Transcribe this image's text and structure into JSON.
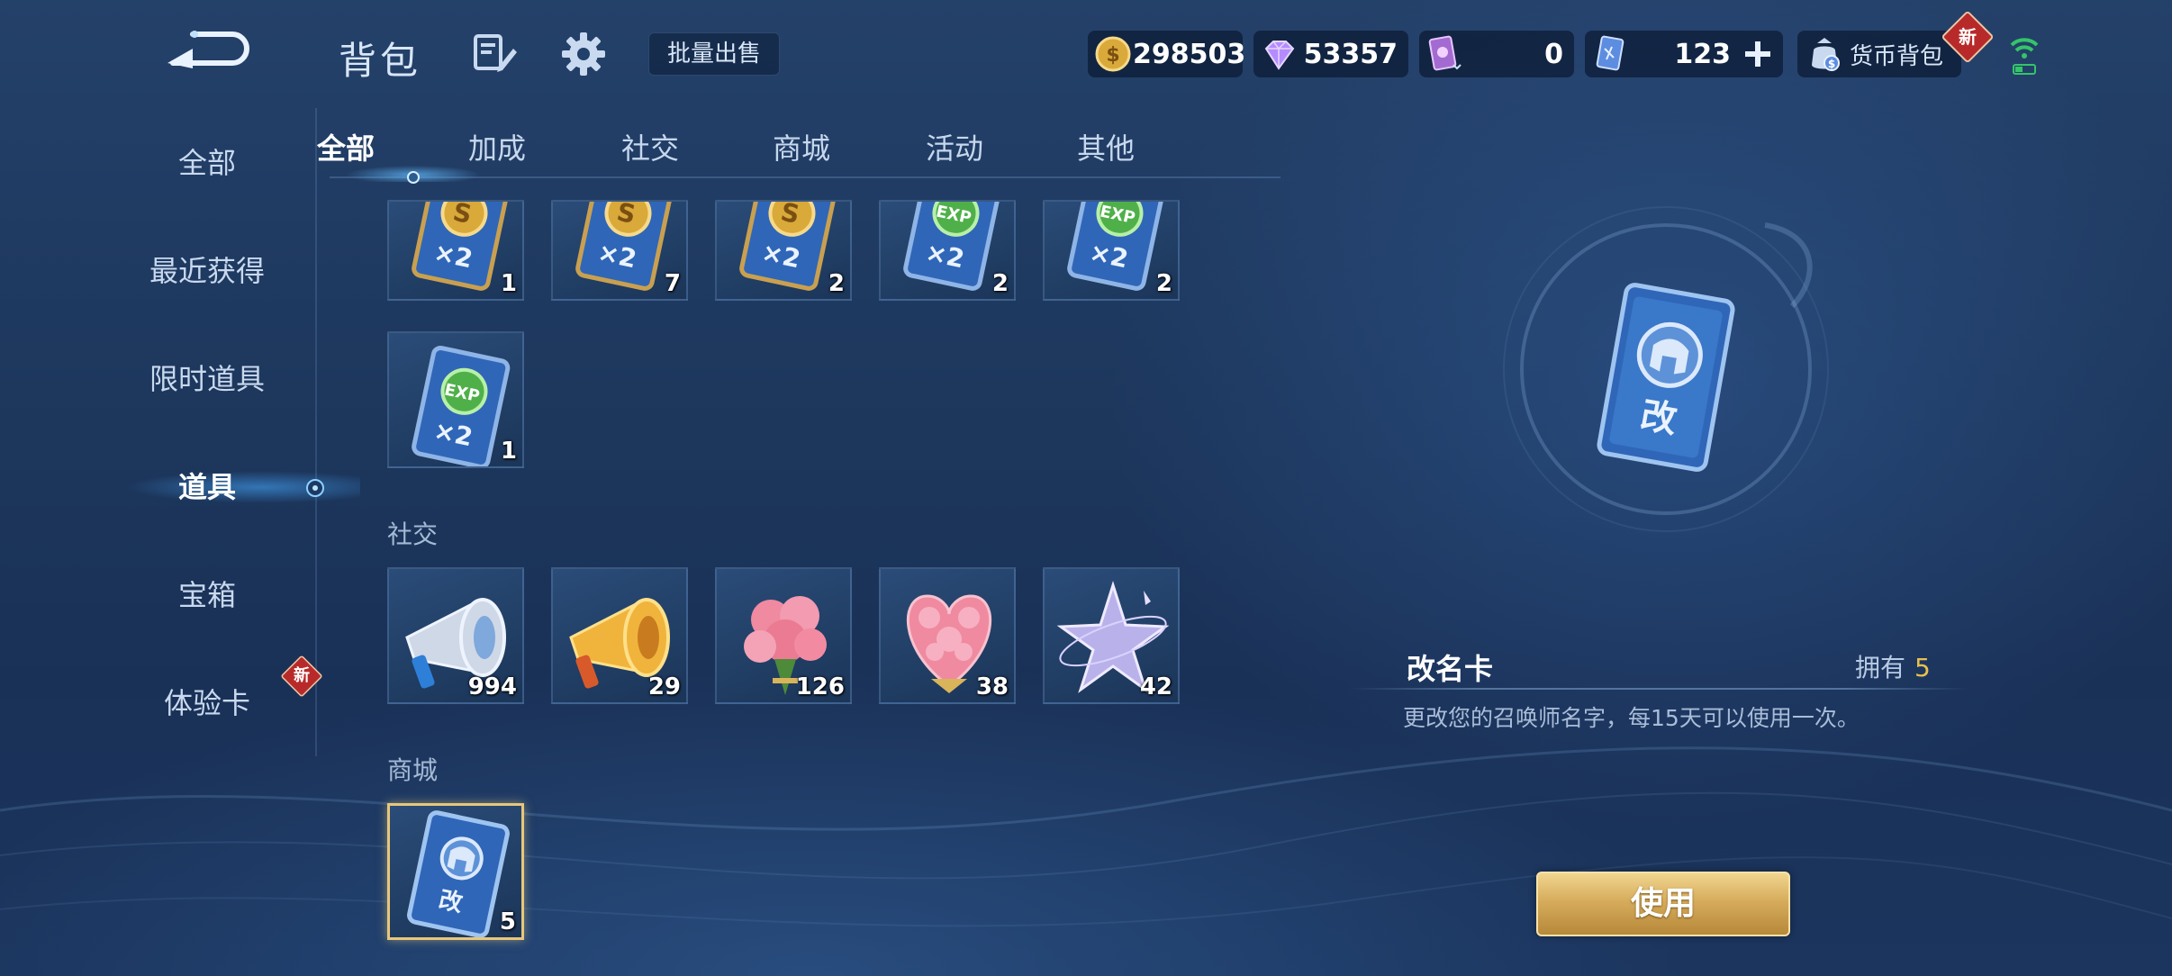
{
  "header": {
    "title": "背包",
    "bulk_sell_label": "批量出售"
  },
  "currencies": [
    {
      "name": "gold-coin",
      "value": "298503",
      "color": "#d9a93a"
    },
    {
      "name": "diamond",
      "value": "53357",
      "color": "#b48cff"
    },
    {
      "name": "hero-ticket",
      "value": "0",
      "color": "#a36bd1"
    },
    {
      "name": "skin-fragment",
      "value": "123",
      "color": "#5d8de0"
    }
  ],
  "wallet": {
    "label": "货币背包",
    "badge": "新"
  },
  "sidebar": {
    "items": [
      {
        "label": "全部"
      },
      {
        "label": "最近获得"
      },
      {
        "label": "限时道具"
      },
      {
        "label": "道具"
      },
      {
        "label": "宝箱"
      },
      {
        "label": "体验卡"
      }
    ],
    "active_index": 3,
    "badge": "新"
  },
  "tabs": {
    "items": [
      {
        "label": "全部"
      },
      {
        "label": "加成"
      },
      {
        "label": "社交"
      },
      {
        "label": "商城"
      },
      {
        "label": "活动"
      },
      {
        "label": "其他"
      }
    ],
    "active_index": 0
  },
  "sections": {
    "bonus": {
      "items": [
        {
          "icon": "gold-x2-card-icon",
          "badge_text": "S",
          "multiplier": "×2",
          "count": "1"
        },
        {
          "icon": "gold-x2-card-icon",
          "badge_text": "S",
          "multiplier": "×2",
          "count": "7"
        },
        {
          "icon": "gold-x2-card-icon",
          "badge_text": "S",
          "multiplier": "×2",
          "count": "2"
        },
        {
          "icon": "exp-x2-card-icon",
          "badge_text": "EXP",
          "multiplier": "×2",
          "count": "2"
        },
        {
          "icon": "exp-x2-card-icon",
          "badge_text": "EXP",
          "multiplier": "×2",
          "count": "2"
        },
        {
          "icon": "exp-x2-card-icon",
          "badge_text": "EXP",
          "multiplier": "×2",
          "count": "1"
        }
      ]
    },
    "social": {
      "label": "社交",
      "items": [
        {
          "icon": "silver-megaphone-icon",
          "count": "994"
        },
        {
          "icon": "gold-megaphone-icon",
          "count": "29"
        },
        {
          "icon": "rose-bouquet-icon",
          "count": "126"
        },
        {
          "icon": "heart-rose-bouquet-icon",
          "count": "38"
        },
        {
          "icon": "crystal-star-icon",
          "count": "42"
        }
      ]
    },
    "shop": {
      "label": "商城",
      "items": [
        {
          "icon": "rename-card-icon",
          "card_text": "改",
          "count": "5"
        }
      ]
    }
  },
  "detail": {
    "name": "改名卡",
    "owned_label": "拥有",
    "owned_count": "5",
    "card_text": "改",
    "description": "更改您的召唤师名字，每15天可以使用一次。",
    "use_label": "使用"
  }
}
